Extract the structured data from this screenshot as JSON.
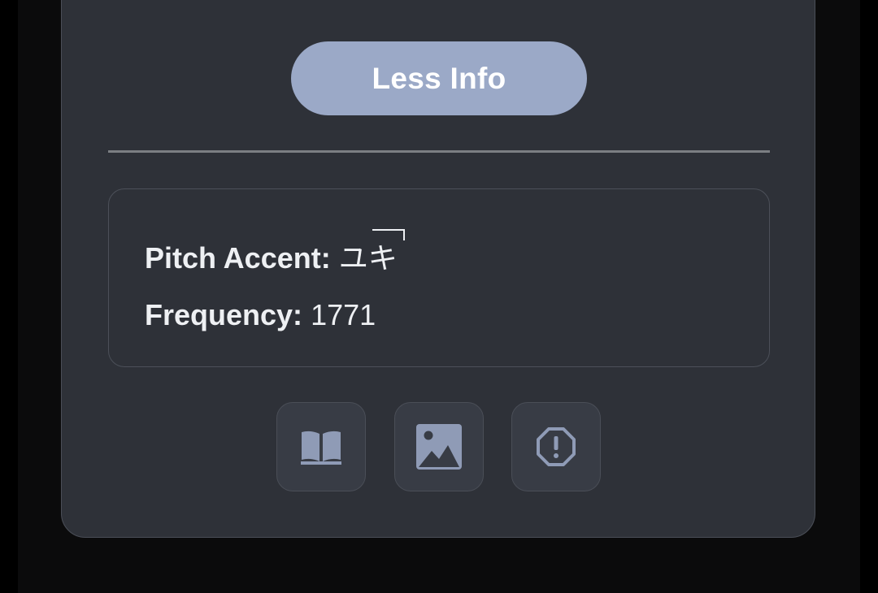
{
  "actions": {
    "less_info_label": "Less Info"
  },
  "details": {
    "pitch_accent_label": "Pitch Accent:",
    "pitch_accent_value": "ユキ",
    "frequency_label": "Frequency:",
    "frequency_value": "1771"
  },
  "toolbar": {
    "buttons": [
      {
        "icon": "book-open-icon"
      },
      {
        "icon": "image-icon"
      },
      {
        "icon": "report-octagon-icon"
      }
    ]
  },
  "colors": {
    "background": "#000000",
    "card": "#2e3138",
    "button_accent": "#9ba9c7",
    "icon": "#8f9bb6",
    "text": "#eef0f3"
  }
}
